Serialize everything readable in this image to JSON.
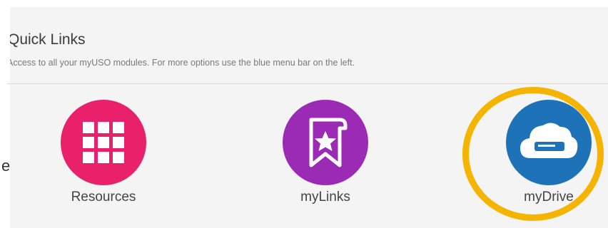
{
  "header": {
    "title": "Quick Links",
    "subtitle": "Access to all your myUSO modules. For more options use the blue menu bar on the left."
  },
  "edge_text": "e",
  "tiles": [
    {
      "label": "Resources",
      "icon": "grid-icon",
      "color": "#e8216a"
    },
    {
      "label": "myLinks",
      "icon": "bookmark-star-icon",
      "color": "#9b2ab5"
    },
    {
      "label": "myDrive",
      "icon": "cloud-drive-icon",
      "color": "#1e72b8"
    }
  ],
  "highlight_color": "#f5b400"
}
